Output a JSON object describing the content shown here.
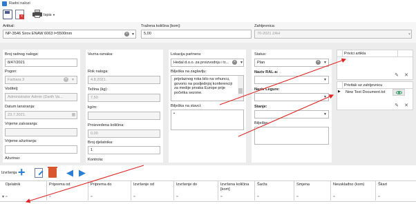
{
  "window": {
    "title": "Radni nalozi"
  },
  "toolbar": {
    "print_label": "Ispis"
  },
  "header": {
    "artikal_label": "Artikal:",
    "artikal_value": "NP-3546 Sirov ENAW 6063 l=5500mm",
    "kolicina_label": "Tražena količina [kom]:",
    "kolicina_value": "5,00",
    "zahtjevnica_label": "Zahtjevnica:",
    "zahtjevnica_value": "70-2021 ZAH"
  },
  "col1": {
    "broj_label": "Broj radnog naloga:",
    "broj_value": "8/47/2021",
    "pogon_label": "Pogon:",
    "pogon_value": "Farbara 3",
    "voditelj_label": "Voditelj:",
    "voditelj_value": "Administrator Admin (Darth Va...",
    "datum_label": "Datum lansiranja:",
    "datum_value": "23.7.2021.",
    "zatvaranja_label": "Vrijeme zatvaranja:",
    "zatvaranja_value": "",
    "azuriranja_label": "Vrijeme ažuriranja:",
    "azuriranja_value": "",
    "azurirao_label": "Ažurirao:"
  },
  "col2": {
    "vezna_label": "Vezna oznaka:",
    "rok_label": "Rok naloga:",
    "rok_value": "4.8.2021.",
    "tezina_label": "Težina (kg):",
    "tezina_value": "7,50",
    "kgm_label": "kg/m:",
    "kgm_value": "",
    "proizvedena_label": "Proizvedena količina:",
    "proizvedena_value": "0,00",
    "broj_djel_label": "Broj djelatnika:",
    "broj_djel_value": "1",
    "kontrola_label": "Kontrola:"
  },
  "col3": {
    "lokacija_label": "Lokacija partnera:",
    "lokacija_value": "Hedal d.o.o. za proizvodnju i tr...",
    "biljeska_zag_label": "Bilješka na zaglavlju:",
    "biljeska_zag_value": "prijelaznog roka bilo na vrhuncu, govorio na posljednjoj konferenciji za medije prvaka Europe prije početka sezone.",
    "biljeska_st_label": "Bilješka na stavci:",
    "biljeska_st_value": "•"
  },
  "col4": {
    "status_label": "Status:",
    "status_value": "Plan",
    "ral_label": "Naziv RAL-a:",
    "legure_label": "Naziv Legure:",
    "stanje_label": "Stanje:",
    "biljeske_label": "Bilješke:"
  },
  "attachments": {
    "artikla_title": "Privici artikla",
    "zahtjevnica_title": "Privitak uz zahtjevnicu",
    "file_name": "New Text Document.txt"
  },
  "bottom_toolbar": {
    "label": "Izvršenja"
  },
  "grid": {
    "headers": [
      "Djelatnik",
      "Priprema od",
      "Priprema do",
      "Izvršenje od",
      "Izvršenje do",
      "Izvršena količina [kom]",
      "Šarža",
      "Smjena",
      "Neusklađno (kom)",
      "Škart"
    ]
  }
}
